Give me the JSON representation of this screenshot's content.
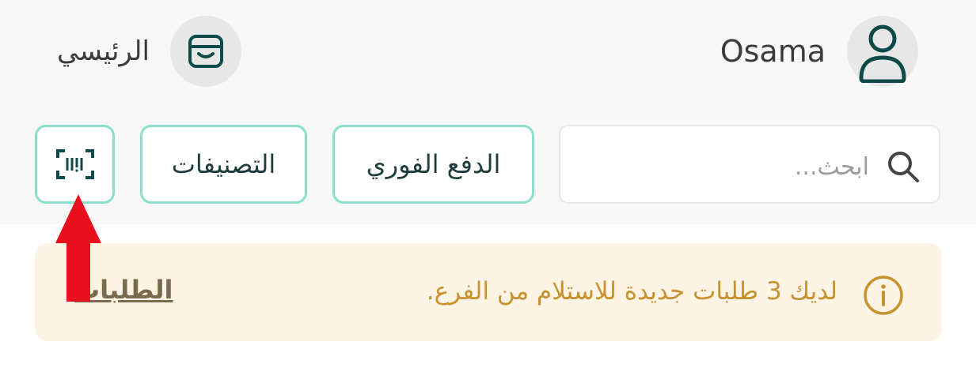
{
  "header": {
    "user_name": "Osama",
    "home_label": "الرئيسي"
  },
  "search": {
    "placeholder": "ابحث..."
  },
  "actions": {
    "instant_payment_label": "الدفع الفوري",
    "categories_label": "التصنيفات"
  },
  "notice": {
    "message": "لديك 3 طلبات جديدة للاستلام من الفرع.",
    "link_label": "الطلبات"
  },
  "colors": {
    "accent_border": "#8be0cc",
    "icon_dark": "#0f4a4a",
    "notice_bg": "#fdf4e6",
    "notice_text": "#c8922e",
    "annotation_red": "#e8101e"
  },
  "icons": {
    "avatar": "user-icon",
    "home": "store-icon",
    "search": "search-icon",
    "scan": "barcode-scan-icon",
    "info": "info-icon",
    "annotation": "red-arrow-up"
  }
}
